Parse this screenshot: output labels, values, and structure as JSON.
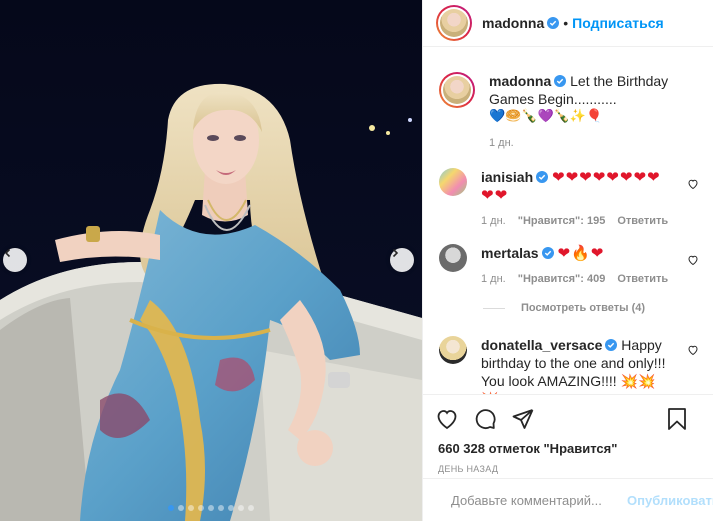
{
  "colors": {
    "accent": "#0095f6",
    "heart": "#e0162b",
    "muted": "#8e8e8e"
  },
  "post": {
    "carousel": {
      "dots": 9,
      "active": 0
    }
  },
  "header": {
    "username": "madonna",
    "separator": "•",
    "follow_label": "Подписаться"
  },
  "caption": {
    "username": "madonna",
    "text": "Let the Birthday Games Begin...........",
    "emojis": "💙🥯🍾💜🍾✨🎈",
    "time": "1 дн."
  },
  "comments": [
    {
      "username": "ianisiah",
      "text": "❤❤❤❤❤❤❤❤❤❤",
      "time": "1 дн.",
      "likes": "\"Нравится\": 195",
      "reply": "Ответить"
    },
    {
      "username": "mertalas",
      "text": "❤🔥❤",
      "time": "1 дн.",
      "likes": "\"Нравится\": 409",
      "reply": "Ответить"
    },
    {
      "username": "donatella_versace",
      "text": "Happy birthday to the one and only!!! You look AMAZING!!!! 💥💥💥"
    }
  ],
  "view_replies": "Посмотреть ответы (4)",
  "actions": {
    "likes_text": "660 328 отметок \"Нравится\"",
    "date": "ДЕНЬ НАЗАД"
  },
  "add_comment": {
    "placeholder": "Добавьте комментарий...",
    "publish": "Опубликовать"
  },
  "icons": [
    "chevron-left-icon",
    "chevron-right-icon",
    "verified-icon",
    "heart-icon",
    "comment-icon",
    "share-icon",
    "bookmark-icon",
    "emoji-icon"
  ]
}
